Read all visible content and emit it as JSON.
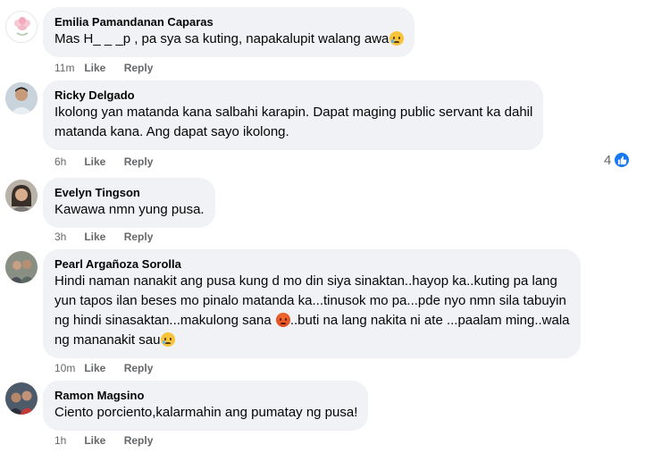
{
  "colors": {
    "bubble_bg": "#f0f2f5",
    "meta_text": "#65676b",
    "like_blue": "#1877f2"
  },
  "comments": [
    {
      "author": "Emilia Pamandanan Caparas",
      "text": "Mas H_ _ _p , pa sya sa kuting, napakalupit walang awa",
      "emoji_end": "sad-tear-emoji",
      "time": "11m",
      "like_label": "Like",
      "reply_label": "Reply"
    },
    {
      "author": "Ricky Delgado",
      "text": "Ikolong yan matanda kana salbahi karapin. Dapat maging public servant ka dahil\nmatanda kana. Ang dapat sayo ikolong.",
      "time": "6h",
      "like_label": "Like",
      "reply_label": "Reply",
      "reaction_count": "4",
      "reaction_icon": "like-reaction-icon"
    },
    {
      "author": "Evelyn Tingson",
      "text": "Kawawa nmn yung pusa.",
      "time": "3h",
      "like_label": "Like",
      "reply_label": "Reply"
    },
    {
      "author": "Pearl Argañoza Sorolla",
      "text_part1": "Hindi naman nanakit ang pusa kung d mo din siya sinaktan..hayop ka..kuting pa lang\nyun tapos ilan beses mo pinalo matanda ka...tinusok mo pa...pde nyo nmn sila tabuyin\nng hindi sinasaktan...makulong sana ",
      "emoji_mid": "angry-emoji",
      "text_part2": "..buti na lang nakita ni ate ...paalam ming..wala\nng mananakit sau",
      "emoji_end": "sad-tear-emoji",
      "time": "10m",
      "like_label": "Like",
      "reply_label": "Reply"
    },
    {
      "author": "Ramon Magsino",
      "text": "Ciento porciento,kalarmahin ang pumatay ng pusa!",
      "time": "1h",
      "like_label": "Like",
      "reply_label": "Reply"
    }
  ]
}
